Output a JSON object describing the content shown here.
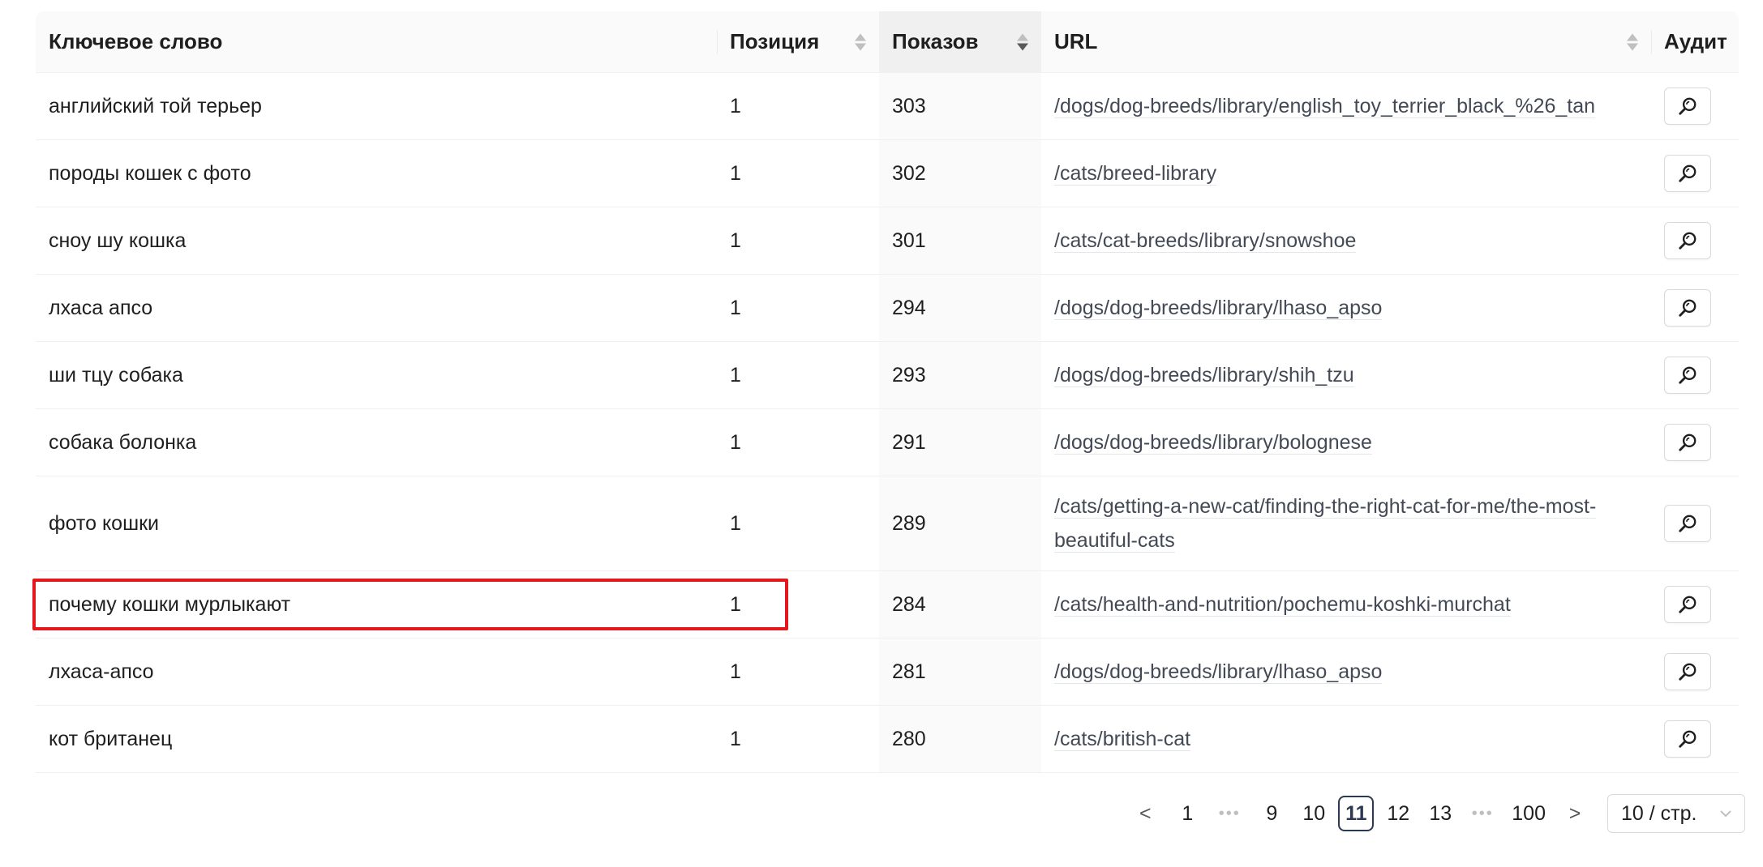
{
  "table": {
    "columns": {
      "keyword": "Ключевое слово",
      "position": "Позиция",
      "impressions": "Показов",
      "url": "URL",
      "audit": "Аудит"
    },
    "rows": [
      {
        "keyword": "английский той терьер",
        "position": "1",
        "impressions": "303",
        "url": "/dogs/dog-breeds/library/english_toy_terrier_black_%26_tan"
      },
      {
        "keyword": "породы кошек с фото",
        "position": "1",
        "impressions": "302",
        "url": "/cats/breed-library"
      },
      {
        "keyword": "сноу шу кошка",
        "position": "1",
        "impressions": "301",
        "url": "/cats/cat-breeds/library/snowshoe"
      },
      {
        "keyword": "лхаса апсо",
        "position": "1",
        "impressions": "294",
        "url": "/dogs/dog-breeds/library/lhaso_apso"
      },
      {
        "keyword": "ши тцу собака",
        "position": "1",
        "impressions": "293",
        "url": "/dogs/dog-breeds/library/shih_tzu"
      },
      {
        "keyword": "собака болонка",
        "position": "1",
        "impressions": "291",
        "url": "/dogs/dog-breeds/library/bolognese"
      },
      {
        "keyword": "фото кошки",
        "position": "1",
        "impressions": "289",
        "url": "/cats/getting-a-new-cat/finding-the-right-cat-for-me/the-most-beautiful-cats"
      },
      {
        "keyword": "почему кошки мурлыкают",
        "position": "1",
        "impressions": "284",
        "url": "/cats/health-and-nutrition/pochemu-koshki-murchat"
      },
      {
        "keyword": "лхаса-апсо",
        "position": "1",
        "impressions": "281",
        "url": "/dogs/dog-breeds/library/lhaso_apso"
      },
      {
        "keyword": "кот британец",
        "position": "1",
        "impressions": "280",
        "url": "/cats/british-cat"
      }
    ]
  },
  "pagination": {
    "prev": "<",
    "next": ">",
    "pages": [
      "1",
      "•••",
      "9",
      "10",
      "11",
      "12",
      "13",
      "•••",
      "100"
    ],
    "current": "11",
    "page_size": "10 / стр."
  },
  "icons": {
    "audit": "search-zoom-icon",
    "sort": "sort-caret-icon",
    "dropdown": "chevron-down-icon"
  },
  "colors": {
    "highlight": "#e5161d",
    "active_page": "#2b3a52"
  }
}
